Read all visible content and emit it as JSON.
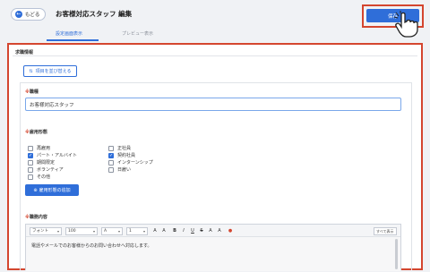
{
  "header": {
    "back_label": "もどる",
    "back_icon": "arrow-left-icon",
    "title": "お客様対応スタッフ 編集",
    "save_label": "保存"
  },
  "tabs": [
    {
      "label": "設定画面表示",
      "active": true
    },
    {
      "label": "プレビュー表示",
      "active": false
    }
  ],
  "section": {
    "title": "求職情報",
    "toggle_label": "項目を並び替える",
    "toggle_icon": "swap-icon"
  },
  "job_type": {
    "required_mark": "※",
    "label": "職種",
    "value": "お客様対応スタッフ"
  },
  "employment": {
    "required_mark": "※",
    "label": "雇用形態",
    "options": [
      {
        "label": "再雇用",
        "checked": false
      },
      {
        "label": "パート・アルバイト",
        "checked": true
      },
      {
        "label": "期間限定",
        "checked": false
      },
      {
        "label": "ボランティア",
        "checked": false
      },
      {
        "label": "その他",
        "checked": false
      },
      {
        "label": "正社員",
        "checked": false
      },
      {
        "label": "契約社員",
        "checked": true
      },
      {
        "label": "インターンシップ",
        "checked": false
      },
      {
        "label": "日雇い",
        "checked": false
      }
    ],
    "add_label": "雇用形態の追加"
  },
  "description": {
    "required_mark": "※",
    "label": "職務内容",
    "toolbar": {
      "font": "フォント",
      "size": "100",
      "style": "A",
      "line_height": "1",
      "buttons": [
        "A",
        "A",
        "B",
        "I",
        "U",
        "S",
        "A",
        "A"
      ],
      "select_all": "すべて表示"
    },
    "text": "電話やメールでのお客様からのお問い合わせへ対応します。"
  },
  "colors": {
    "accent": "#2f6ed9",
    "highlight": "#d4462f"
  }
}
